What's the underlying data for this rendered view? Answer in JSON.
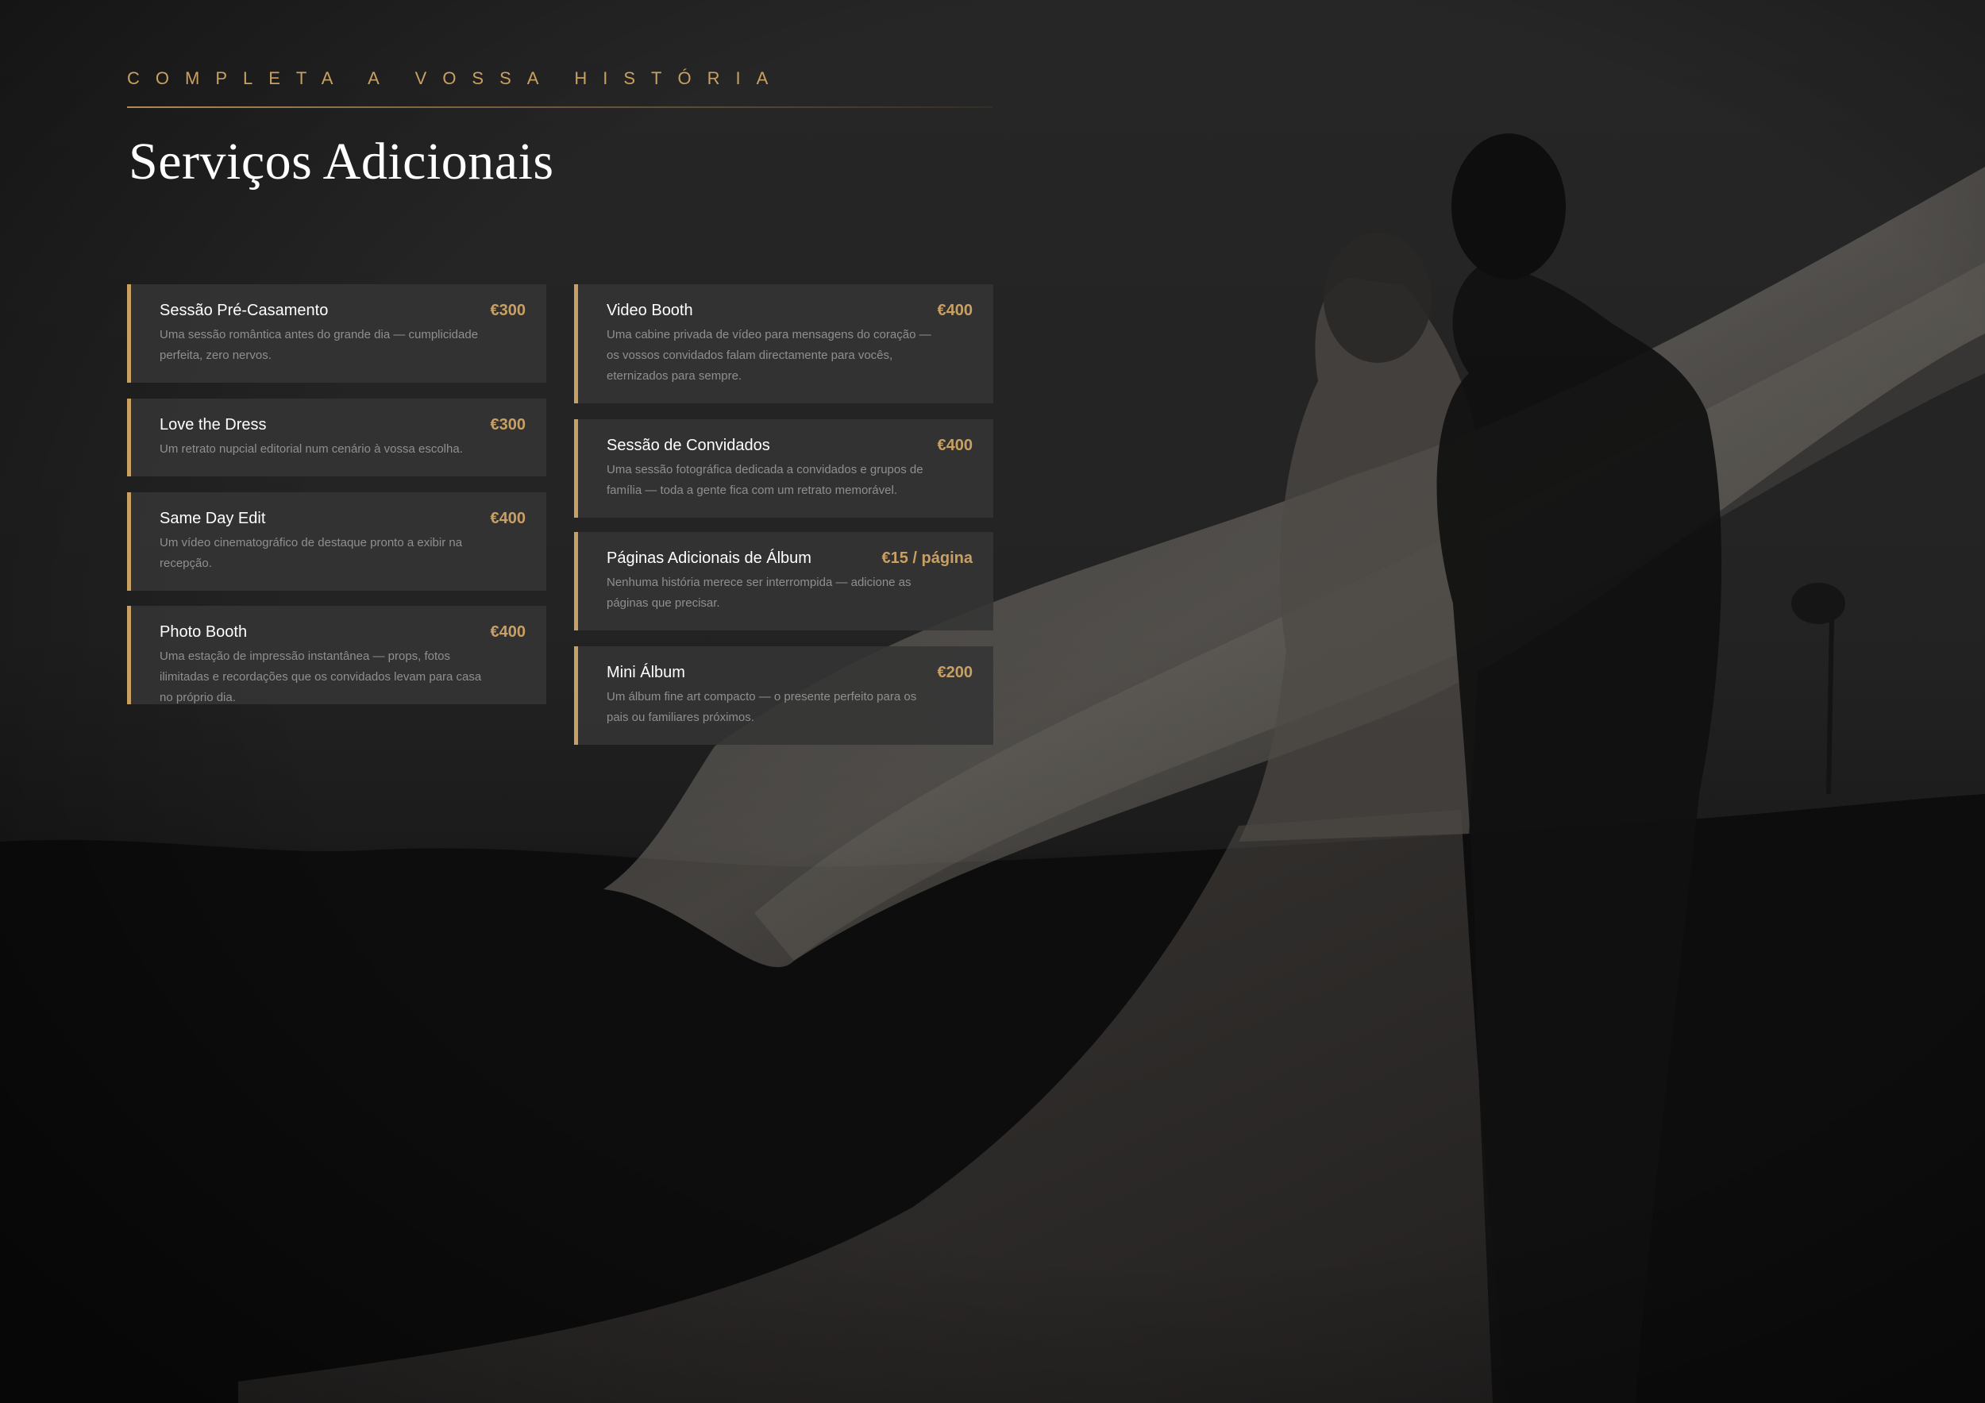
{
  "header": {
    "eyebrow": "Completa a vossa história",
    "title": "Serviços Adicionais"
  },
  "services_left": [
    {
      "title": "Sessão Pré-Casamento",
      "price": "€300",
      "description": "Uma sessão romântica antes do grande dia — cumplicidade perfeita, zero nervos."
    },
    {
      "title": "Love the Dress",
      "price": "€300",
      "description": "Um retrato nupcial editorial num cenário à vossa escolha."
    },
    {
      "title": "Same Day Edit",
      "price": "€400",
      "description": "Um vídeo cinematográfico de destaque pronto a exibir na recepção."
    },
    {
      "title": "Photo Booth",
      "price": "€400",
      "description": "Uma estação de impressão instantânea — props, fotos ilimitadas e recordações que os convidados levam para casa no próprio dia."
    }
  ],
  "services_right": [
    {
      "title": "Video Booth",
      "price": "€400",
      "description": "Uma cabine privada de vídeo para mensagens do coração — os vossos convidados falam directamente para vocês, eternizados para sempre."
    },
    {
      "title": "Sessão de Convidados",
      "price": "€400",
      "description": "Uma sessão fotográfica dedicada a convidados e grupos de família — toda a gente fica com um retrato memorável."
    },
    {
      "title": "Páginas Adicionais de Álbum",
      "price": "€15 / página",
      "description": "Nenhuma história merece ser interrompida — adicione as páginas que precisar."
    },
    {
      "title": "Mini Álbum",
      "price": "€200",
      "description": "Um álbum fine art compacto — o presente perfeito para os pais ou familiares próximos."
    }
  ],
  "colors": {
    "accent": "#c9a063",
    "background": "#232323",
    "card": "#343434"
  }
}
